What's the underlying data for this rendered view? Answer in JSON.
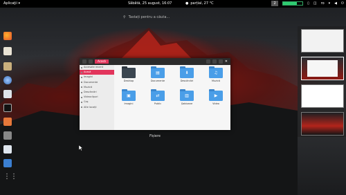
{
  "topbar": {
    "activities": "Aplicaţii ▾",
    "clock": "Sâbâtă, 25 august, 16:07",
    "weather": "parțial, 27 °C",
    "keyboard": "ro",
    "sys_label": "2",
    "battery_percent": 70
  },
  "search": {
    "placeholder": "Tastați pentru a căuta..."
  },
  "dash": {
    "apps": [
      "firefox",
      "files",
      "keys",
      "web",
      "office",
      "terminal",
      "updates",
      "settings",
      "store",
      "grid"
    ]
  },
  "window": {
    "location": "Acasă",
    "sidebar": [
      "Accesate recent",
      "Acasă",
      "Imagini",
      "Documente",
      "Muzică",
      "Descărcări",
      "Videoclipuri",
      "Coș",
      "Alte locații"
    ],
    "folders": [
      {
        "label": "Desktop",
        "icon": "desktop"
      },
      {
        "label": "Documente",
        "icon": "doc"
      },
      {
        "label": "Descărcări",
        "icon": "download"
      },
      {
        "label": "Muzică",
        "icon": "music"
      },
      {
        "label": "Imagini",
        "icon": "pictures"
      },
      {
        "label": "Public",
        "icon": "share"
      },
      {
        "label": "Șabloane",
        "icon": "templates"
      },
      {
        "label": "Video",
        "icon": "video"
      }
    ]
  },
  "window_title": "Fișiere",
  "workspaces": {
    "active": 1,
    "count": 4
  }
}
